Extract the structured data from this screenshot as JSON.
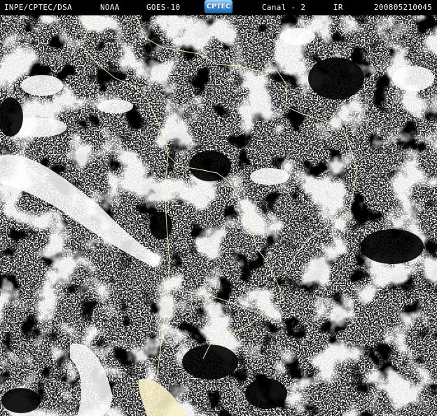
{
  "header": {
    "institution": "INPE/CPTEC/DSA",
    "agency": "NOAA",
    "satellite": "GOES-10",
    "logo_text": "CPTEC",
    "channel": "Canal - 2",
    "band": "IR",
    "timestamp": "200805210045"
  },
  "colors": {
    "background": "#000000",
    "cloud": "#ffffff",
    "border_lines": "#fff8c8",
    "header_text": "#ffffff"
  },
  "image": {
    "content": "satellite-imagery-south-america",
    "visible_features": [
      "cloud-cover",
      "country-borders",
      "coastlines"
    ]
  }
}
